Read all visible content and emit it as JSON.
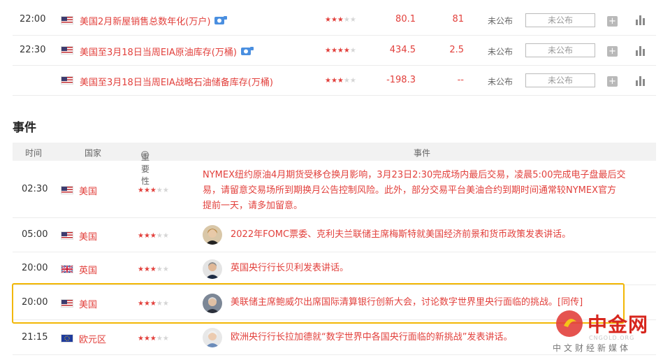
{
  "indicators": [
    {
      "time": "22:00",
      "country": "美国",
      "name": "美国2月新屋销售总数年化(万户)",
      "video": true,
      "stars": 3,
      "previous": "80.1",
      "forecast": "81",
      "actual": "未公布",
      "actual_box": "未公布"
    },
    {
      "time": "22:30",
      "country": "美国",
      "name": "美国至3月18日当周EIA原油库存(万桶)",
      "video": true,
      "stars": 4,
      "previous": "434.5",
      "forecast": "2.5",
      "actual": "未公布",
      "actual_box": "未公布"
    },
    {
      "time": "",
      "country": "美国",
      "name": "美国至3月18日当周EIA战略石油储备库存(万桶)",
      "video": false,
      "stars": 3,
      "previous": "-198.3",
      "forecast": "--",
      "actual": "未公布",
      "actual_box": "未公布"
    }
  ],
  "events_section": {
    "title": "事件",
    "headers": {
      "time": "时间",
      "country": "国家",
      "importance": "重要性",
      "event": "事件"
    },
    "rows": [
      {
        "time": "02:30",
        "country": "美国",
        "flag": "us",
        "stars": 3,
        "avatar": false,
        "lines": [
          "NYMEX纽约原油4月期货受移仓换月影响，3月23日2:30完成场内最后交易，凌晨5:00完成电子盘最后交",
          "易，请留意交易场所到期换月公告控制风险。此外，部分交易平台美油合约到期时间通常较NYMEX官方",
          "提前一天，请多加留意。"
        ]
      },
      {
        "time": "05:00",
        "country": "美国",
        "flag": "us",
        "stars": 3,
        "avatar": true,
        "lines": [
          "2022年FOMC票委、克利夫兰联储主席梅斯特就美国经济前景和货币政策发表讲话。"
        ]
      },
      {
        "time": "20:00",
        "country": "英国",
        "flag": "uk",
        "stars": 3,
        "avatar": true,
        "lines": [
          "英国央行行长贝利发表讲话。"
        ]
      },
      {
        "time": "20:00",
        "country": "美国",
        "flag": "us",
        "stars": 3,
        "avatar": true,
        "lines": [
          "美联储主席鲍威尔出席国际清算银行创新大会，讨论数字世界里央行面临的挑战。[同传]"
        ]
      },
      {
        "time": "21:15",
        "country": "欧元区",
        "flag": "eu",
        "stars": 3,
        "avatar": true,
        "lines": [
          "欧洲央行行长拉加德就“数字世界中各国央行面临的新挑战”发表讲话。"
        ]
      }
    ]
  },
  "watermark": {
    "brand": "中金网",
    "domain": "CNGOLD.ORG",
    "tagline": "中文财经新媒体"
  },
  "colors": {
    "accent": "#e2403c",
    "highlight": "#f2b705"
  }
}
